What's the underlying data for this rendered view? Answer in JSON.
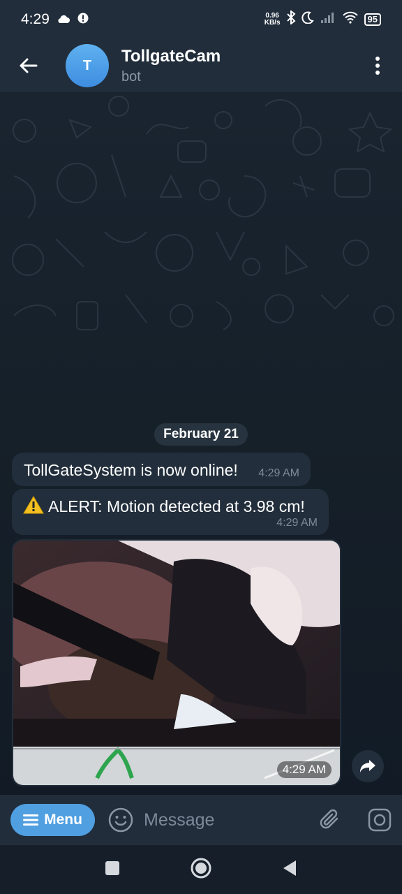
{
  "status_bar": {
    "time": "4:29",
    "net_speed_value": "0.96",
    "net_speed_unit": "KB/s",
    "battery": "95",
    "icons": [
      "cloud-icon",
      "alert-circle-icon",
      "bluetooth-icon",
      "moon-icon",
      "cell-signal-icon",
      "wifi-icon",
      "battery-icon"
    ]
  },
  "header": {
    "avatar_letter": "T",
    "title": "TollgateCam",
    "subtitle": "bot",
    "colors": {
      "avatar": "#4a9de8",
      "header_bg": "#212d3b"
    }
  },
  "chat": {
    "date": "February 21",
    "messages": [
      {
        "text": "TollGateSystem is now online!",
        "time": "4:29 AM"
      },
      {
        "icon": "warning-icon",
        "text": "ALERT: Motion detected at 3.98 cm!",
        "time": "4:29 AM"
      },
      {
        "type": "photo",
        "time": "4:29 AM"
      }
    ]
  },
  "input_bar": {
    "menu_label": "Menu",
    "placeholder": "Message",
    "colors": {
      "menu_button": "#4f9fe1"
    }
  }
}
